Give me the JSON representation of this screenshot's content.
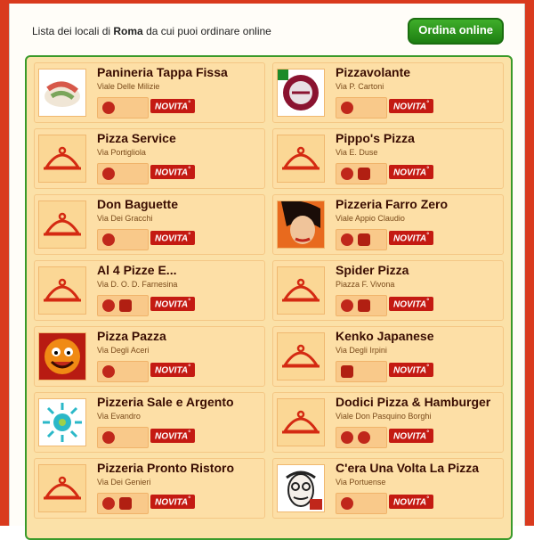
{
  "header": {
    "text_before": "Lista dei locali di ",
    "city": "Roma",
    "text_after": " da cui puoi ordinare online",
    "order_button": "Ordina online"
  },
  "badge_label": "NOVITA",
  "restaurants": [
    {
      "name": "Panineria Tappa Fissa",
      "address": "Viale Delle Milizie",
      "icons": [
        "burger-icon"
      ],
      "thumb": "photo"
    },
    {
      "name": "Pizzavolante",
      "address": "Via P. Cartoni",
      "icons": [
        "pizza-slice-icon"
      ],
      "thumb": "logo"
    },
    {
      "name": "Pizza Service",
      "address": "Via Portigliola",
      "icons": [
        "pizza-slice-icon"
      ],
      "thumb": "cloche"
    },
    {
      "name": "Pippo's Pizza",
      "address": "Via E. Duse",
      "icons": [
        "pizza-slice-icon",
        "kebab-icon"
      ],
      "thumb": "cloche"
    },
    {
      "name": "Don Baguette",
      "address": "Via Dei Gracchi",
      "icons": [
        "burger-icon"
      ],
      "thumb": "cloche"
    },
    {
      "name": "Pizzeria Farro Zero",
      "address": "Viale Appio Claudio",
      "icons": [
        "pizza-slice-icon",
        "kebab-icon"
      ],
      "thumb": "face"
    },
    {
      "name": "Al 4 Pizze E...",
      "address": "Via D. O. D. Farnesina",
      "icons": [
        "pizza-slice-icon",
        "cutlery-icon"
      ],
      "thumb": "cloche"
    },
    {
      "name": "Spider Pizza",
      "address": "Piazza F. Vivona",
      "icons": [
        "pizza-slice-icon",
        "cutlery-icon"
      ],
      "thumb": "cloche"
    },
    {
      "name": "Pizza Pazza",
      "address": "Via Degli Aceri",
      "icons": [
        "pizza-slice-icon"
      ],
      "thumb": "smiley"
    },
    {
      "name": "Kenko Japanese",
      "address": "Via Degli Irpini",
      "icons": [
        "sushi-icon"
      ],
      "thumb": "cloche"
    },
    {
      "name": "Pizzeria Sale e Argento",
      "address": "Via Evandro",
      "icons": [
        "pizza-slice-icon"
      ],
      "thumb": "sun"
    },
    {
      "name": "Dodici Pizza & Hamburger",
      "address": "Viale Don Pasquino Borghi",
      "icons": [
        "pizza-slice-icon",
        "burger-icon"
      ],
      "thumb": "cloche"
    },
    {
      "name": "Pizzeria Pronto Ristoro",
      "address": "Via Dei Genieri",
      "icons": [
        "pizza-slice-icon",
        "cutlery-icon"
      ],
      "thumb": "cloche"
    },
    {
      "name": "C'era Una Volta La Pizza",
      "address": "Via Portuense",
      "icons": [
        "pizza-slice-icon"
      ],
      "thumb": "portrait"
    }
  ]
}
